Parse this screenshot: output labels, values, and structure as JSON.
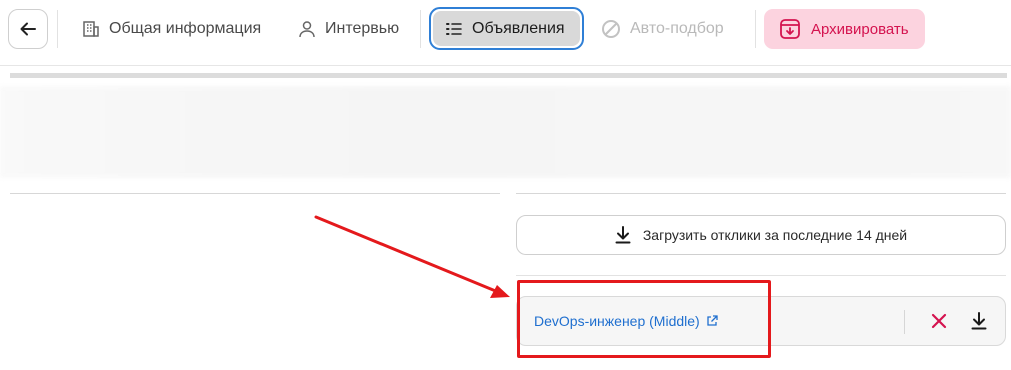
{
  "toolbar": {
    "tabs": [
      {
        "label": "Общая информация",
        "icon": "building-icon",
        "state": "normal"
      },
      {
        "label": "Интервью",
        "icon": "user-icon",
        "state": "normal"
      },
      {
        "label": "Объявления",
        "icon": "list-icon",
        "state": "active"
      },
      {
        "label": "Авто-подбор",
        "icon": "ban-icon",
        "state": "disabled"
      }
    ],
    "archive_label": "Архивировать"
  },
  "main": {
    "download_label": "Загрузить отклики за последние 14 дней",
    "vacancy": {
      "title": "DevOps-инженер (Middle)"
    }
  },
  "colors": {
    "accent": "#2f7fd6",
    "danger": "#d4134f",
    "archive_bg": "#fcd3df",
    "link": "#1f6fcf",
    "annotation": "#e4191c"
  }
}
